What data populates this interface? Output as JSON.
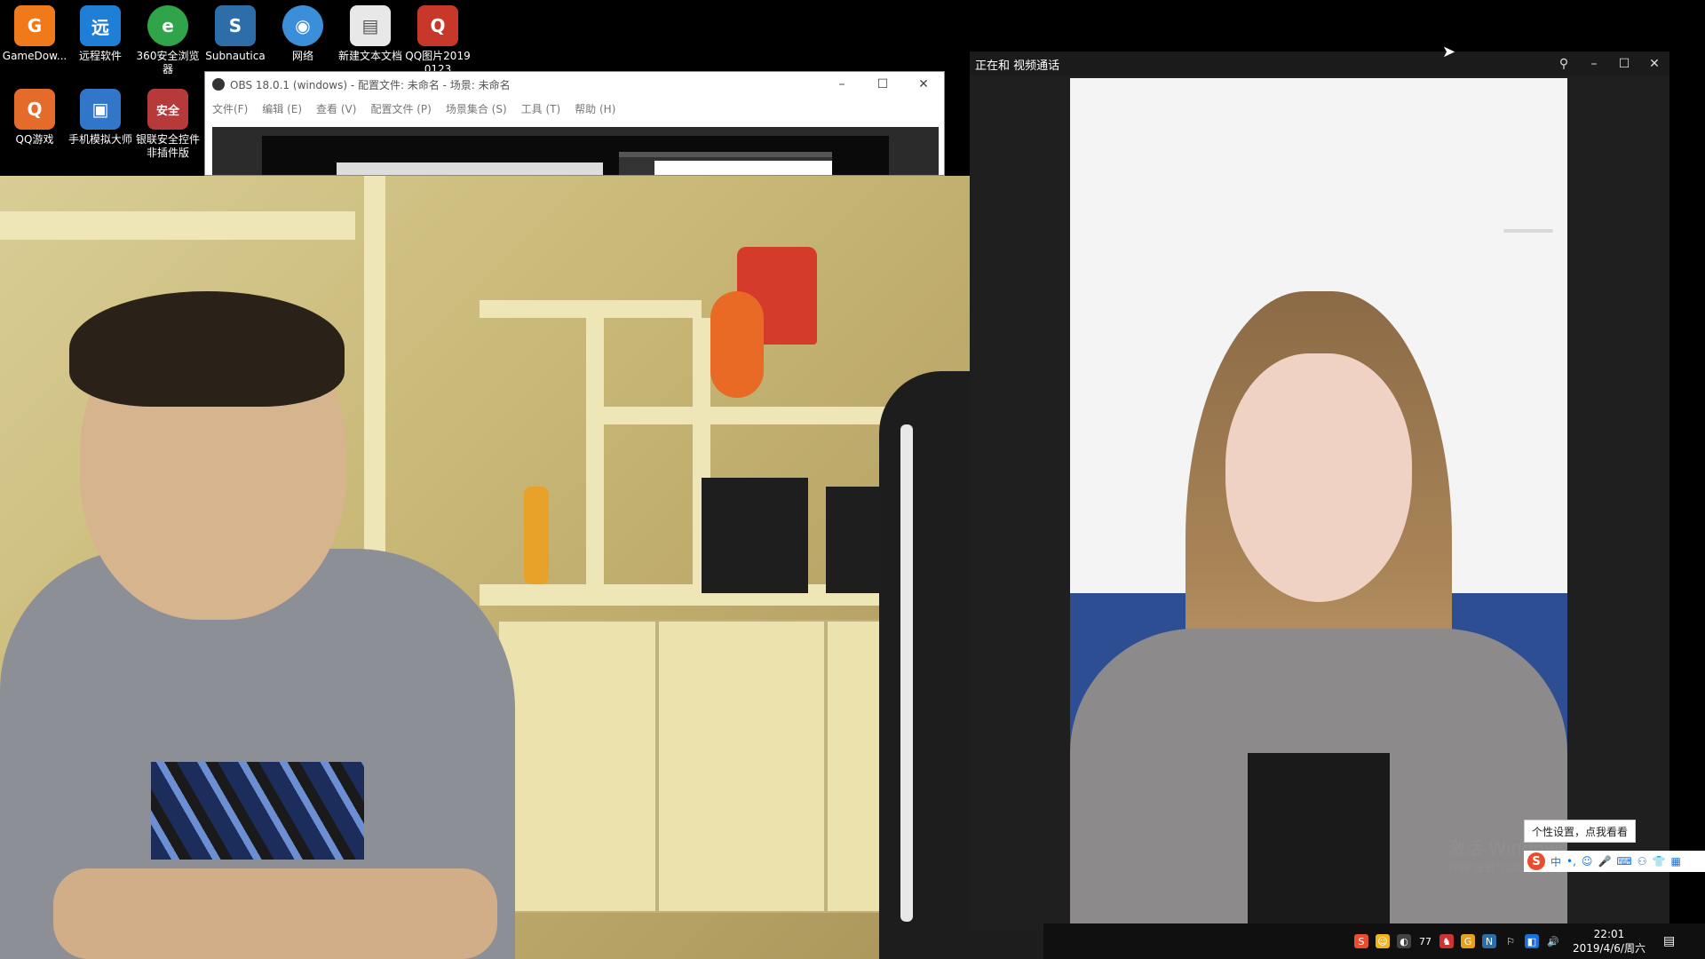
{
  "desktop": {
    "icons": [
      {
        "label": "GameDow...",
        "glyph": "G",
        "color": "#f07a1a"
      },
      {
        "label": "远程软件",
        "glyph": "远",
        "color": "#1f7fd6"
      },
      {
        "label": "360安全浏览器",
        "glyph": "e",
        "color": "#2fa44a"
      },
      {
        "label": "Subnautica",
        "glyph": "S",
        "color": "#2d6ea8"
      },
      {
        "label": "网络",
        "glyph": "◉",
        "color": "#3b8fd8"
      },
      {
        "label": "新建文本文档",
        "glyph": "▤",
        "color": "#e8e8e8"
      },
      {
        "label": "QQ图片20190123",
        "glyph": "Q",
        "color": "#c8382a"
      },
      {
        "label": "QQ游戏",
        "glyph": "Q",
        "color": "#e46b2a"
      },
      {
        "label": "手机模拟大师",
        "glyph": "▣",
        "color": "#3276c9"
      },
      {
        "label": "银联安全控件非插件版",
        "glyph": "安全",
        "color": "#b73a3a"
      }
    ]
  },
  "obs": {
    "title": "OBS 18.0.1 (windows) - 配置文件: 未命名 - 场景: 未命名",
    "menu": [
      "文件(F)",
      "编辑 (E)",
      "查看 (V)",
      "配置文件 (P)",
      "场景集合 (S)",
      "工具 (T)",
      "帮助 (H)"
    ],
    "controls": {
      "minimize": "–",
      "maximize": "☐",
      "close": "✕"
    }
  },
  "call": {
    "title": "正在和 视频通话",
    "controls": {
      "pin": "⚲",
      "minimize": "–",
      "maximize": "☐",
      "close": "✕"
    }
  },
  "ime": {
    "tooltip": "个性设置，点我看看",
    "logo": "S",
    "mode": "中",
    "items": [
      "•,",
      "☺",
      "🎤",
      "⌨",
      "⚇",
      "👕",
      "▦"
    ]
  },
  "watermark": {
    "line1": "激活 Windows",
    "line2": "转到\"设置\"以激活 Windows。"
  },
  "taskbar": {
    "time": "22:01",
    "date": "2019/4/6/周六",
    "tray_icons": [
      "S",
      "☺",
      "◐",
      "77",
      "♞",
      "G",
      "N",
      "⚐",
      "◧",
      "🔊"
    ],
    "notification": "▤"
  },
  "colors": {
    "accent": "#1d6fd8",
    "sogou": "#e94d2e"
  }
}
